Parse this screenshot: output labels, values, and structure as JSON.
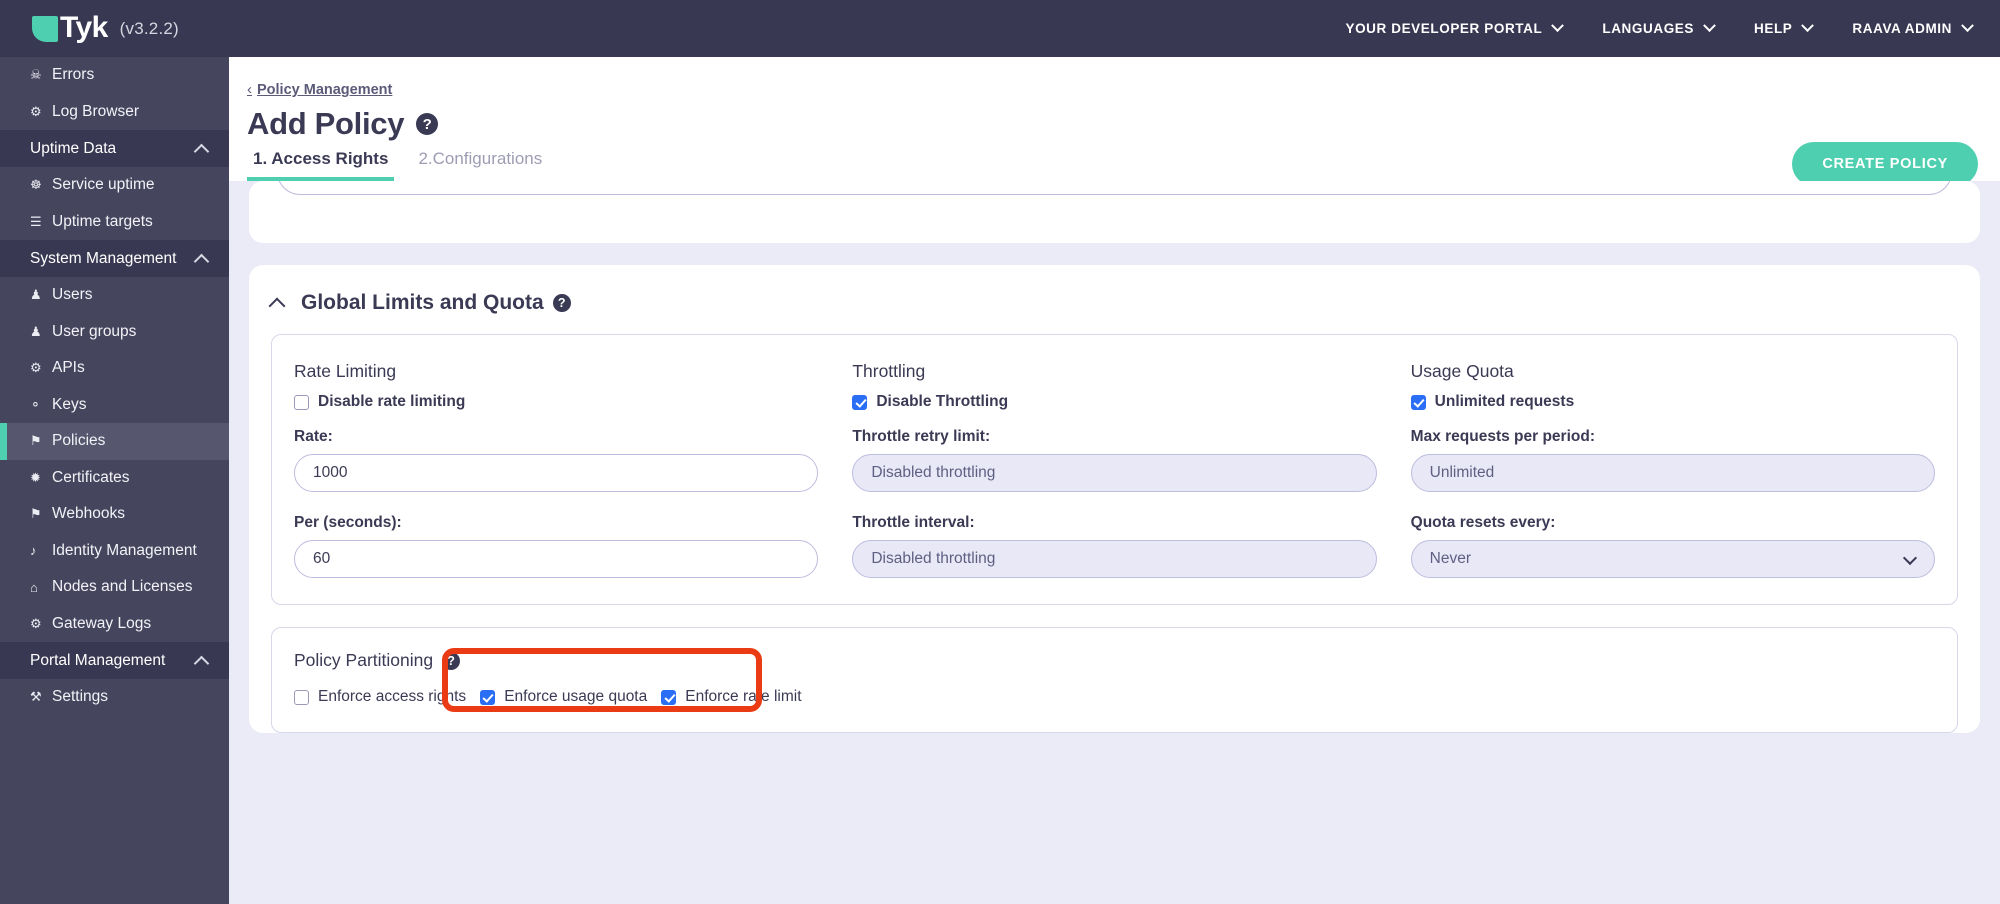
{
  "topbar": {
    "brand_name": "Tyk",
    "version": "(v3.2.2)",
    "nav": [
      {
        "label": "YOUR DEVELOPER PORTAL"
      },
      {
        "label": "LANGUAGES"
      },
      {
        "label": "HELP"
      },
      {
        "label": "RAAVA ADMIN"
      }
    ]
  },
  "sidebar": {
    "items": [
      {
        "type": "link",
        "icon": "bug-icon",
        "glyph": "☠",
        "label": "Errors",
        "active": false
      },
      {
        "type": "link",
        "icon": "log-browser-icon",
        "glyph": "⚙",
        "label": "Log Browser",
        "active": false
      },
      {
        "type": "group",
        "label": "Uptime Data"
      },
      {
        "type": "link",
        "icon": "service-uptime-icon",
        "glyph": "☸",
        "label": "Service uptime",
        "active": false
      },
      {
        "type": "link",
        "icon": "uptime-targets-icon",
        "glyph": "☰",
        "label": "Uptime targets",
        "active": false
      },
      {
        "type": "group",
        "label": "System Management"
      },
      {
        "type": "link",
        "icon": "user-icon",
        "glyph": "♟",
        "label": "Users",
        "active": false
      },
      {
        "type": "link",
        "icon": "user-groups-icon",
        "glyph": "♟",
        "label": "User groups",
        "active": false
      },
      {
        "type": "link",
        "icon": "apis-gear-icon",
        "glyph": "⚙",
        "label": "APIs",
        "active": false
      },
      {
        "type": "link",
        "icon": "keys-sitemap-icon",
        "glyph": "⚬",
        "label": "Keys",
        "active": false
      },
      {
        "type": "link",
        "icon": "policies-icon",
        "glyph": "⚑",
        "label": "Policies",
        "active": true
      },
      {
        "type": "link",
        "icon": "certificates-icon",
        "glyph": "✹",
        "label": "Certificates",
        "active": false
      },
      {
        "type": "link",
        "icon": "webhooks-bell-icon",
        "glyph": "⚑",
        "label": "Webhooks",
        "active": false
      },
      {
        "type": "link",
        "icon": "identity-management-icon",
        "glyph": "♪",
        "label": "Identity Management",
        "active": false
      },
      {
        "type": "link",
        "icon": "nodes-licenses-icon",
        "glyph": "⌂",
        "label": "Nodes and Licenses",
        "active": false
      },
      {
        "type": "link",
        "icon": "gateway-logs-icon",
        "glyph": "⚙",
        "label": "Gateway Logs",
        "active": false
      },
      {
        "type": "group",
        "label": "Portal Management"
      },
      {
        "type": "link",
        "icon": "settings-wrench-icon",
        "glyph": "⚒",
        "label": "Settings",
        "active": false
      }
    ]
  },
  "page": {
    "breadcrumb_arrow": "‹",
    "breadcrumb": "Policy Management",
    "title": "Add Policy",
    "help_glyph": "?",
    "create_button": "CREATE POLICY",
    "tabs": [
      {
        "label": "1. Access Rights",
        "active": true
      },
      {
        "label": "2.Configurations",
        "active": false
      }
    ]
  },
  "global_limits": {
    "section_title": "Global Limits and Quota",
    "rate_limiting": {
      "title": "Rate Limiting",
      "checkbox_label": "Disable rate limiting",
      "checkbox_checked": false,
      "rate_label": "Rate:",
      "rate_value": "1000",
      "per_label": "Per (seconds):",
      "per_value": "60"
    },
    "throttling": {
      "title": "Throttling",
      "checkbox_label": "Disable Throttling",
      "checkbox_checked": true,
      "retry_label": "Throttle retry limit:",
      "retry_value": "Disabled throttling",
      "interval_label": "Throttle interval:",
      "interval_value": "Disabled throttling"
    },
    "usage_quota": {
      "title": "Usage Quota",
      "checkbox_label": "Unlimited requests",
      "checkbox_checked": true,
      "max_label": "Max requests per period:",
      "max_value": "Unlimited",
      "resets_label": "Quota resets every:",
      "resets_value": "Never"
    }
  },
  "policy_partitioning": {
    "title": "Policy Partitioning",
    "checks": [
      {
        "label": "Enforce access rights",
        "checked": false
      },
      {
        "label": "Enforce usage quota",
        "checked": true
      },
      {
        "label": "Enforce rate limit",
        "checked": true
      }
    ]
  },
  "colors": {
    "brand_teal": "#4ecfaf",
    "topbar_dark": "#393852",
    "sidebar": "#46455e",
    "sidebar_active": "#57566f",
    "page_bg": "#ebebf7",
    "text_dark": "#3b3a55",
    "checkbox_blue": "#2a6ef5",
    "highlight_red": "#ea3b15",
    "input_border": "#bdbdde",
    "input_disabled_bg": "#e8e8f7"
  }
}
